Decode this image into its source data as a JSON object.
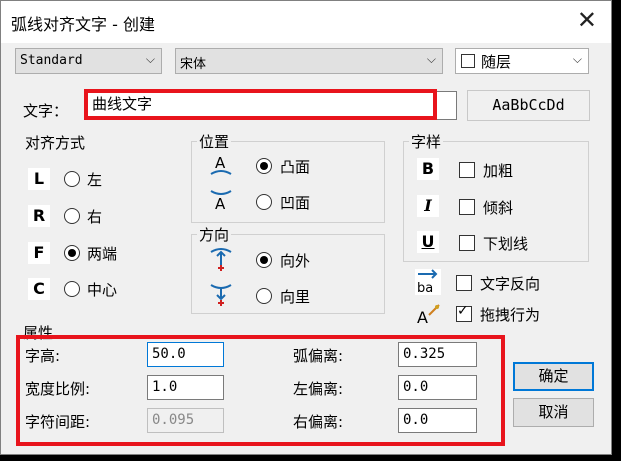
{
  "window": {
    "title": "弧线对齐文字 - 创建",
    "close_glyph": "✕"
  },
  "toolbar": {
    "style_value": "Standard",
    "font_value": "宋体",
    "layer_label": "随层"
  },
  "text_row": {
    "label": "文字：",
    "value": "曲线文字",
    "preview": "AaBbCcDd"
  },
  "align": {
    "title": "对齐方式",
    "items": [
      {
        "icon": "L",
        "label": "左",
        "selected": false
      },
      {
        "icon": "R",
        "label": "右",
        "selected": false
      },
      {
        "icon": "F",
        "label": "两端",
        "selected": true
      },
      {
        "icon": "C",
        "label": "中心",
        "selected": false
      }
    ]
  },
  "position": {
    "title": "位置",
    "items": [
      {
        "label": "凸面",
        "selected": true
      },
      {
        "label": "凹面",
        "selected": false
      }
    ]
  },
  "direction": {
    "title": "方向",
    "items": [
      {
        "label": "向外",
        "selected": true
      },
      {
        "label": "向里",
        "selected": false
      }
    ]
  },
  "font_style": {
    "title": "字样",
    "items": [
      {
        "icon": "B",
        "label": "加粗",
        "checked": false
      },
      {
        "icon": "I",
        "label": "倾斜",
        "checked": false
      },
      {
        "icon": "U",
        "label": "下划线",
        "checked": false
      }
    ]
  },
  "extras": [
    {
      "label": "文字反向",
      "checked": false
    },
    {
      "label": "拖拽行为",
      "checked": true
    }
  ],
  "properties": {
    "title": "属性",
    "char_height_label": "字高:",
    "char_height": "50.0",
    "width_ratio_label": "宽度比例:",
    "width_ratio": "1.0",
    "char_spacing_label": "字符间距:",
    "char_spacing": "0.095",
    "arc_offset_label": "弧偏离:",
    "arc_offset": "0.325",
    "left_offset_label": "左偏离:",
    "left_offset": "0.0",
    "right_offset_label": "右偏离:",
    "right_offset": "0.0"
  },
  "buttons": {
    "ok": "确定",
    "cancel": "取消"
  },
  "colors": {
    "highlight": "#e8141c",
    "focus": "#0078d7"
  }
}
